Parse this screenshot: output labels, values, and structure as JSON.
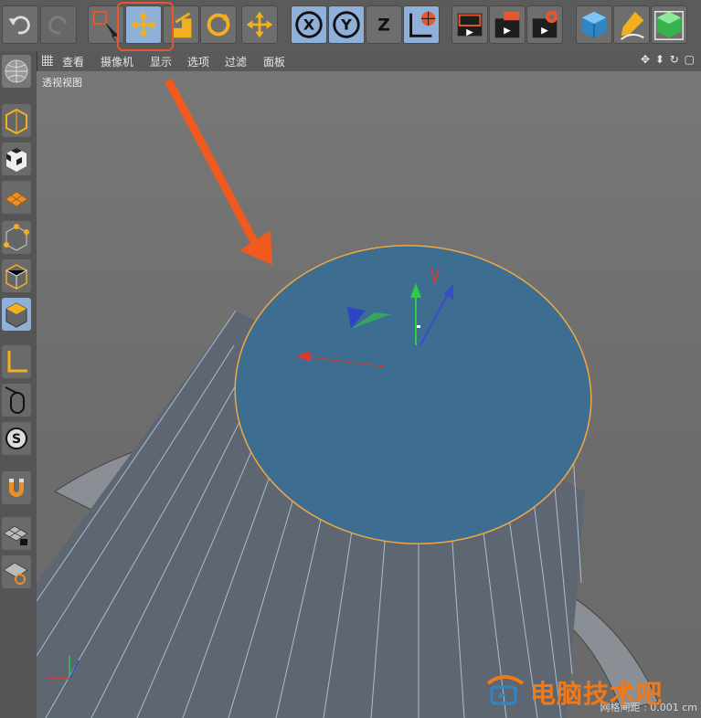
{
  "menubar": {
    "items": [
      "查看",
      "摄像机",
      "显示",
      "选项",
      "过滤",
      "面板"
    ]
  },
  "viewport": {
    "label": "透视视图",
    "grid_spacing": "网格间距 : 0.001 cm"
  },
  "toolbar": {
    "axis_x": "X",
    "axis_y": "Y",
    "axis_z": "Z"
  },
  "watermark": {
    "text": "电脑技术吧"
  },
  "colors": {
    "accent_orange": "#e8562b",
    "active_blue": "#8fb0d8",
    "face_blue": "#3e6d92"
  },
  "icons": [
    "undo-icon",
    "redo-icon",
    "live-selection-icon",
    "move-icon",
    "scale-icon",
    "rotate-icon",
    "move-alt-icon",
    "x-axis-icon",
    "y-axis-icon",
    "z-axis-icon",
    "coordinate-system-icon",
    "render-view-icon",
    "render-picture-viewer-icon",
    "render-settings-icon",
    "cube-icon",
    "pen-icon",
    "primitive-icon",
    "magnet-icon"
  ]
}
